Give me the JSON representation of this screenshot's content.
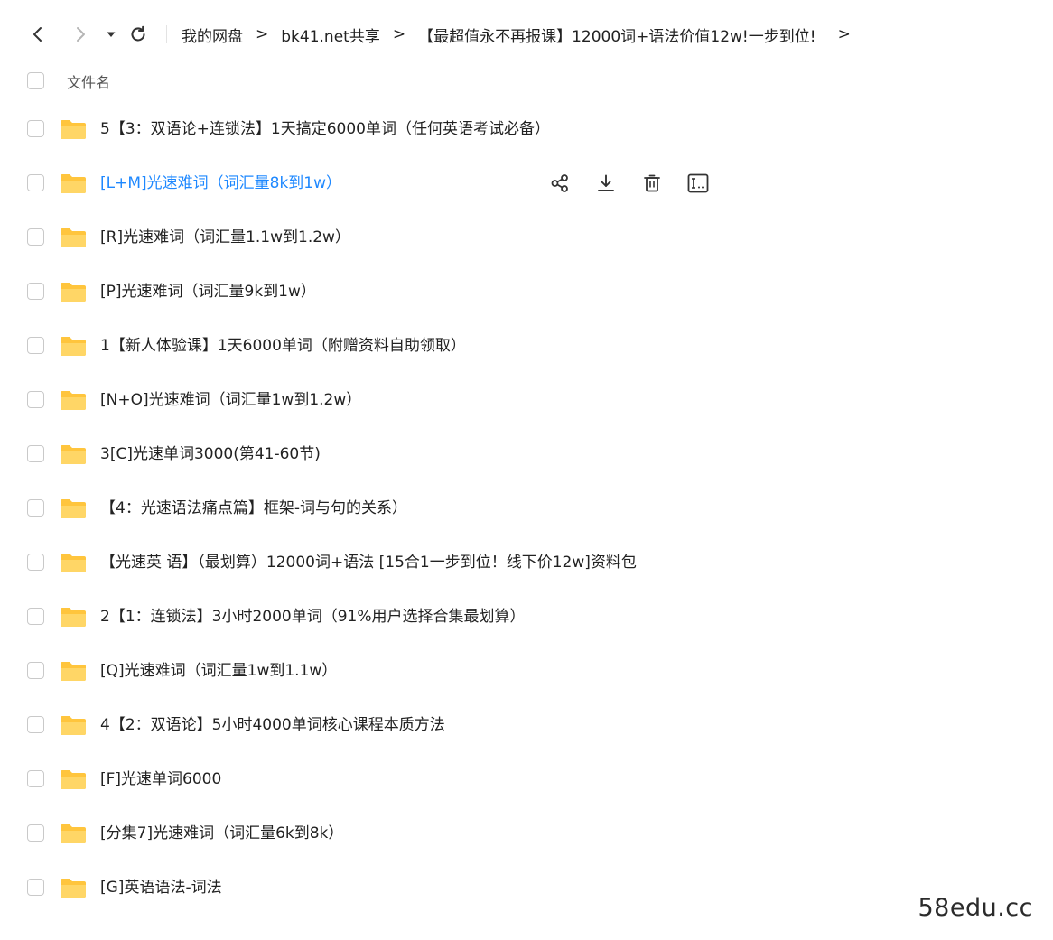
{
  "breadcrumb": {
    "items": [
      "我的网盘",
      "bk41.net共享",
      "【最超值永不再报课】12000词+语法价值12w!一步到位!"
    ],
    "separator": ">"
  },
  "header": {
    "column_name": "文件名"
  },
  "actions": {
    "share_icon": "share-icon",
    "download_icon": "download-icon",
    "delete_icon": "trash-icon",
    "rename_icon": "rename-icon"
  },
  "colors": {
    "accent": "#1e88ff",
    "folder": "#ffc53d"
  },
  "files": [
    {
      "name": "5【3：双语论+连锁法】1天搞定6000单词（任何英语考试必备）"
    },
    {
      "name": "[L+M]光速难词（词汇量8k到1w）"
    },
    {
      "name": "[R]光速难词（词汇量1.1w到1.2w）"
    },
    {
      "name": "[P]光速难词（词汇量9k到1w）"
    },
    {
      "name": "1【新人体验课】1天6000单词（附赠资料自助领取）"
    },
    {
      "name": "[N+O]光速难词（词汇量1w到1.2w）"
    },
    {
      "name": "3[C]光速单词3000(第41-60节)"
    },
    {
      "name": "【4：光速语法痛点篇】框架-词与句的关系）"
    },
    {
      "name": "【光速英 语】（最划算）12000词+语法 [15合1一步到位！线下价12w]资料包"
    },
    {
      "name": "2【1：连锁法】3小时2000单词（91%用户选择合集最划算）"
    },
    {
      "name": "[Q]光速难词（词汇量1w到1.1w）"
    },
    {
      "name": "4【2：双语论】5小时4000单词核心课程本质方法"
    },
    {
      "name": "[F]光速单词6000"
    },
    {
      "name": "[分集7]光速难词（词汇量6k到8k）"
    },
    {
      "name": "[G]英语语法-词法"
    }
  ],
  "watermark": "58edu.cc"
}
